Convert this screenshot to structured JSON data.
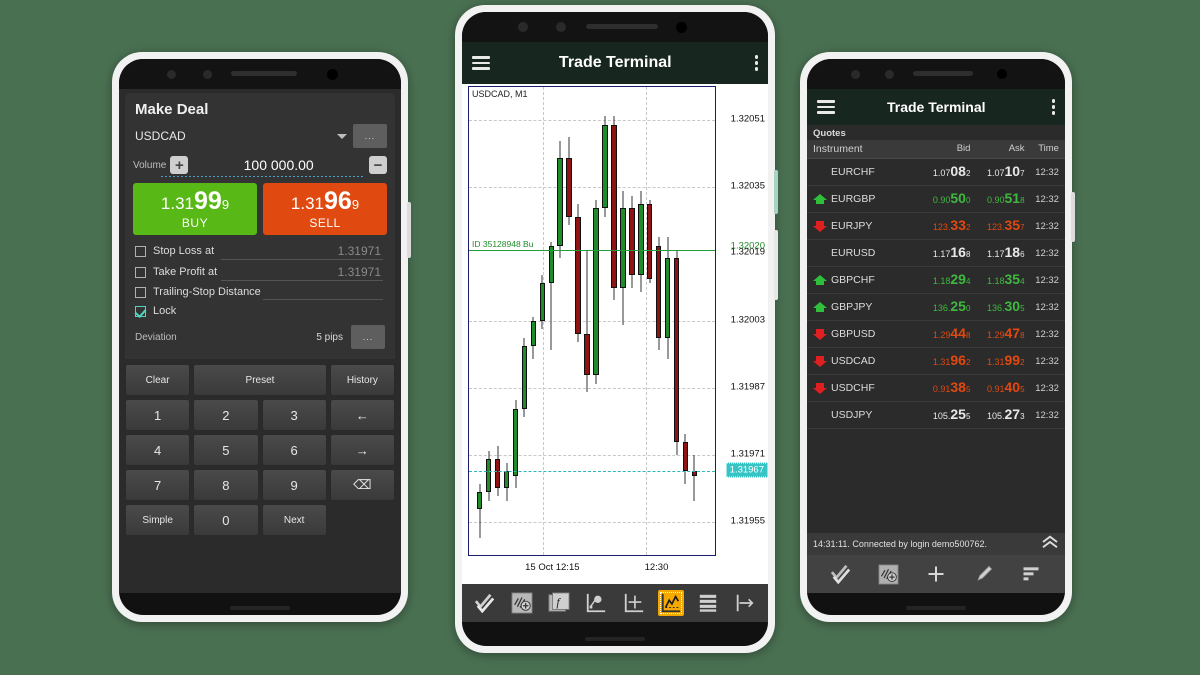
{
  "background_color": "#4a7052",
  "left_phone": {
    "app": {
      "title": "Make Deal",
      "symbol": "USDCAD",
      "more_button": "...",
      "volume_label": "Volume",
      "volume_value": "100 000.00",
      "plus_label": "+",
      "minus_label": "−",
      "buy": {
        "price_pre": "1.31",
        "price_big": "99",
        "price_post": "9",
        "label": "BUY",
        "color": "#57b816"
      },
      "sell": {
        "price_pre": "1.31",
        "price_big": "96",
        "price_post": "9",
        "label": "SELL",
        "color": "#e0490f"
      },
      "options": [
        {
          "label": "Stop Loss at",
          "value": "1.31971",
          "checked": false
        },
        {
          "label": "Take Profit at",
          "value": "1.31971",
          "checked": false
        },
        {
          "label": "Trailing-Stop Distance",
          "value": "",
          "checked": false
        },
        {
          "label": "Lock",
          "value": "",
          "checked": true
        }
      ],
      "deviation_label": "Deviation",
      "deviation_value": "5 pips",
      "deviation_button": "...",
      "keypad": [
        "Clear",
        "Preset",
        "History",
        "1",
        "2",
        "3",
        "←",
        "4",
        "5",
        "6",
        "→",
        "7",
        "8",
        "9",
        "⌫",
        "Simple",
        "0",
        "Next"
      ]
    }
  },
  "center_phone": {
    "app": {
      "title": "Trade Terminal",
      "menu_icon": "hamburger-icon",
      "overflow_icon": "kebab-icon"
    },
    "chart": {
      "symbol_period": "USDCAD, M1",
      "order_label": "ID 35128948 Bu",
      "price_ticks": [
        "1.32051",
        "1.32035",
        "1.32003",
        "1.31987",
        "1.31971",
        "1.31955"
      ],
      "order_price_label": "1.32020",
      "grid_price_label": "1.32019",
      "bid_price_label": "1.31967",
      "time_ticks": [
        "15 Oct 12:15",
        "12:30"
      ],
      "toolbar_icons": [
        "checkmarks-icon",
        "indicators-icon",
        "function-icon",
        "objects-icon",
        "crosshair-icon",
        "chart-type-icon",
        "list-icon",
        "scale-icon"
      ],
      "active_toolbar_index": 5
    }
  },
  "right_phone": {
    "app": {
      "title": "Trade Terminal",
      "menu_icon": "hamburger-icon",
      "overflow_icon": "kebab-icon"
    },
    "quotes": {
      "section_title": "Quotes",
      "columns": [
        "Instrument",
        "Bid",
        "Ask",
        "Time"
      ],
      "rows": [
        {
          "arrow": "none",
          "instrument": "EURCHF",
          "bid": [
            "1.07",
            "08",
            "2"
          ],
          "ask": [
            "1.07",
            "10",
            "7"
          ],
          "dir": "neutral",
          "time": "12:32"
        },
        {
          "arrow": "up",
          "instrument": "EURGBP",
          "bid": [
            "0.90",
            "50",
            "0"
          ],
          "ask": [
            "0.90",
            "51",
            "8"
          ],
          "dir": "up",
          "time": "12:32"
        },
        {
          "arrow": "down",
          "instrument": "EURJPY",
          "bid": [
            "123.",
            "33",
            "2"
          ],
          "ask": [
            "123.",
            "35",
            "7"
          ],
          "dir": "dn",
          "time": "12:32"
        },
        {
          "arrow": "none",
          "instrument": "EURUSD",
          "bid": [
            "1.17",
            "16",
            "8"
          ],
          "ask": [
            "1.17",
            "18",
            "6"
          ],
          "dir": "neutral",
          "time": "12:32"
        },
        {
          "arrow": "up",
          "instrument": "GBPCHF",
          "bid": [
            "1.18",
            "29",
            "4"
          ],
          "ask": [
            "1.18",
            "35",
            "4"
          ],
          "dir": "up",
          "time": "12:32"
        },
        {
          "arrow": "up",
          "instrument": "GBPJPY",
          "bid": [
            "136.",
            "25",
            "0"
          ],
          "ask": [
            "136.",
            "30",
            "5"
          ],
          "dir": "up",
          "time": "12:32"
        },
        {
          "arrow": "down",
          "instrument": "GBPUSD",
          "bid": [
            "1.29",
            "44",
            "8"
          ],
          "ask": [
            "1.29",
            "47",
            "8"
          ],
          "dir": "dn",
          "time": "12:32"
        },
        {
          "arrow": "down",
          "instrument": "USDCAD",
          "bid": [
            "1.31",
            "96",
            "2"
          ],
          "ask": [
            "1.31",
            "99",
            "2"
          ],
          "dir": "dn",
          "time": "12:32"
        },
        {
          "arrow": "down",
          "instrument": "USDCHF",
          "bid": [
            "0.91",
            "38",
            "5"
          ],
          "ask": [
            "0.91",
            "40",
            "5"
          ],
          "dir": "dn",
          "time": "12:32"
        },
        {
          "arrow": "none",
          "instrument": "USDJPY",
          "bid": [
            "105.",
            "25",
            "5"
          ],
          "ask": [
            "105.",
            "27",
            "3"
          ],
          "dir": "neutral",
          "time": "12:32"
        }
      ]
    },
    "status": {
      "text": "14:31:11. Connected by login demo500762.",
      "expand_icon": "chevron-up-icon"
    },
    "toolbar_icons": [
      "checkmarks-icon",
      "indicators-icon",
      "plus-icon",
      "pencil-icon",
      "sort-icon"
    ]
  },
  "chart_data": {
    "type": "candlestick",
    "title": "USDCAD, M1",
    "xlabel": "",
    "ylabel": "",
    "ylim": [
      1.31947,
      1.32059
    ],
    "price_ticks": [
      1.32051,
      1.32035,
      1.32003,
      1.31987,
      1.31971,
      1.31955
    ],
    "time_ticks": [
      "15 Oct 12:15",
      "12:30"
    ],
    "order_line": 1.3202,
    "bid_line": 1.31967,
    "candles": [
      {
        "o": 1.31958,
        "h": 1.31964,
        "l": 1.31951,
        "c": 1.31962
      },
      {
        "o": 1.31962,
        "h": 1.31972,
        "l": 1.3196,
        "c": 1.3197
      },
      {
        "o": 1.3197,
        "h": 1.31973,
        "l": 1.31961,
        "c": 1.31963
      },
      {
        "o": 1.31963,
        "h": 1.31969,
        "l": 1.3196,
        "c": 1.31967
      },
      {
        "o": 1.31966,
        "h": 1.31984,
        "l": 1.31963,
        "c": 1.31982
      },
      {
        "o": 1.31982,
        "h": 1.31999,
        "l": 1.3198,
        "c": 1.31997
      },
      {
        "o": 1.31997,
        "h": 1.32004,
        "l": 1.31994,
        "c": 1.32003
      },
      {
        "o": 1.32003,
        "h": 1.32014,
        "l": 1.32001,
        "c": 1.32012
      },
      {
        "o": 1.32012,
        "h": 1.32022,
        "l": 1.31996,
        "c": 1.32021
      },
      {
        "o": 1.32021,
        "h": 1.32046,
        "l": 1.32018,
        "c": 1.32042
      },
      {
        "o": 1.32042,
        "h": 1.32047,
        "l": 1.32026,
        "c": 1.32028
      },
      {
        "o": 1.32028,
        "h": 1.32031,
        "l": 1.31998,
        "c": 1.32
      },
      {
        "o": 1.32,
        "h": 1.3202,
        "l": 1.31986,
        "c": 1.3199
      },
      {
        "o": 1.3199,
        "h": 1.32032,
        "l": 1.31988,
        "c": 1.3203
      },
      {
        "o": 1.3203,
        "h": 1.32052,
        "l": 1.32028,
        "c": 1.3205
      },
      {
        "o": 1.3205,
        "h": 1.32052,
        "l": 1.32008,
        "c": 1.32011
      },
      {
        "o": 1.32011,
        "h": 1.32034,
        "l": 1.32002,
        "c": 1.3203
      },
      {
        "o": 1.3203,
        "h": 1.32033,
        "l": 1.32011,
        "c": 1.32014
      },
      {
        "o": 1.32014,
        "h": 1.32034,
        "l": 1.3201,
        "c": 1.32031
      },
      {
        "o": 1.32031,
        "h": 1.32032,
        "l": 1.32012,
        "c": 1.32013
      },
      {
        "o": 1.32021,
        "h": 1.32023,
        "l": 1.31996,
        "c": 1.31999
      },
      {
        "o": 1.31999,
        "h": 1.32023,
        "l": 1.31994,
        "c": 1.32018
      },
      {
        "o": 1.32018,
        "h": 1.3202,
        "l": 1.31971,
        "c": 1.31974
      },
      {
        "o": 1.31974,
        "h": 1.31976,
        "l": 1.31964,
        "c": 1.31967
      },
      {
        "o": 1.31967,
        "h": 1.31971,
        "l": 1.3196,
        "c": 1.31966
      }
    ]
  }
}
